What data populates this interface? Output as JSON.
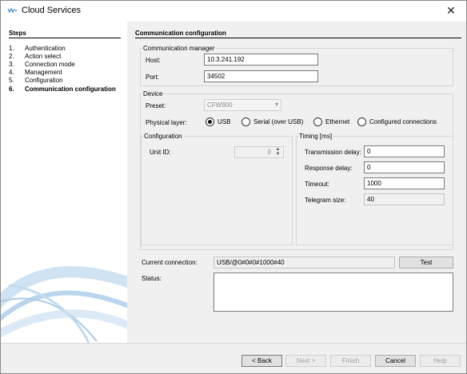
{
  "window": {
    "title": "Cloud Services",
    "close_glyph": "✕"
  },
  "steps": {
    "heading": "Steps",
    "items": [
      {
        "num": "1.",
        "label": "Authentication"
      },
      {
        "num": "2.",
        "label": "Action select"
      },
      {
        "num": "3.",
        "label": "Connection mode"
      },
      {
        "num": "4.",
        "label": "Management"
      },
      {
        "num": "5.",
        "label": "Configuration"
      },
      {
        "num": "6.",
        "label": "Communication configuration",
        "current": true
      }
    ]
  },
  "main": {
    "heading": "Communication configuration",
    "comm_manager": {
      "legend": "Communication manager",
      "host_label": "Host:",
      "host_value": "10.3.241.192",
      "port_label": "Port:",
      "port_value": "34502"
    },
    "device": {
      "legend": "Device",
      "preset_label": "Preset:",
      "preset_value": "CFW900",
      "physical_layer_label": "Physical layer:",
      "physical_layer_options": [
        {
          "label": "USB",
          "selected": true
        },
        {
          "label": "Serial (over USB)",
          "selected": false
        },
        {
          "label": "Ethernet",
          "selected": false
        },
        {
          "label": "Configured connections",
          "selected": false
        }
      ],
      "configuration": {
        "legend": "Configuration",
        "unit_id_label": "Unit ID:",
        "unit_id_value": "0"
      },
      "timing": {
        "legend": "Timing [ms]",
        "transmission_delay_label": "Transmission delay:",
        "transmission_delay_value": "0",
        "response_delay_label": "Response delay:",
        "response_delay_value": "0",
        "timeout_label": "Timeout:",
        "timeout_value": "1000",
        "telegram_size_label": "Telegram size:",
        "telegram_size_value": "40"
      }
    },
    "current_connection_label": "Current connection:",
    "current_connection_value": "USB/@0#0#0#1000#40",
    "test_label": "Test",
    "status_label": "Status:",
    "status_value": ""
  },
  "footer": {
    "back": "< Back",
    "next": "Next >",
    "finish": "Finish",
    "cancel": "Cancel",
    "help": "Help"
  },
  "colors": {
    "brand_blue": "#3b8fd0",
    "window_bg": "#f0f0f0"
  }
}
